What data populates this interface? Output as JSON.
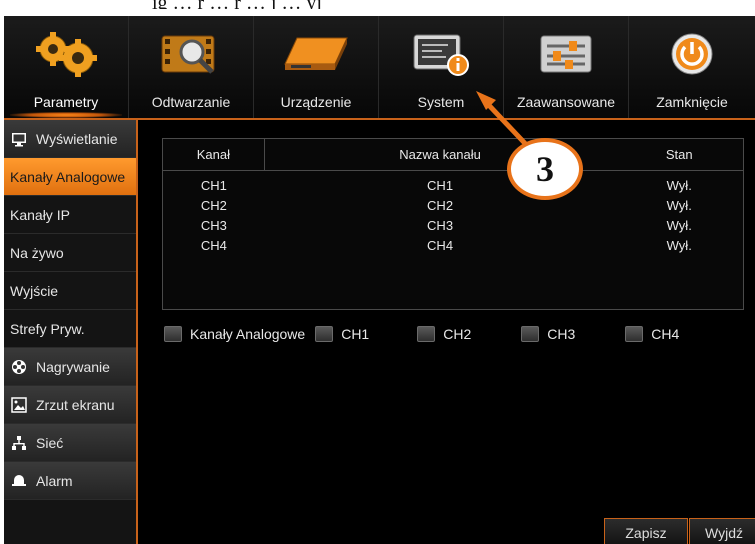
{
  "caption": {
    "text": "ig … ŕ … ŕ … j … yj"
  },
  "toolbar": {
    "items": [
      {
        "label": "Parametry",
        "icon": "gears-icon",
        "active": true
      },
      {
        "label": "Odtwarzanie",
        "icon": "film-search-icon",
        "active": false
      },
      {
        "label": "Urządzenie",
        "icon": "hard-drive-icon",
        "active": false
      },
      {
        "label": "System",
        "icon": "system-info-icon",
        "active": false
      },
      {
        "label": "Zaawansowane",
        "icon": "sliders-icon",
        "active": false
      },
      {
        "label": "Zamknięcie",
        "icon": "power-icon",
        "active": false
      }
    ]
  },
  "sidebar": {
    "items": [
      {
        "label": "Wyświetlanie",
        "icon": "monitor-icon",
        "kind": "section"
      },
      {
        "label": "Kanały Analogowe",
        "kind": "active"
      },
      {
        "label": "Kanały IP",
        "kind": "sub"
      },
      {
        "label": "Na żywo",
        "kind": "sub"
      },
      {
        "label": "Wyjście",
        "kind": "sub"
      },
      {
        "label": "Strefy Pryw.",
        "kind": "sub"
      },
      {
        "label": "Nagrywanie",
        "icon": "reel-icon",
        "kind": "section"
      },
      {
        "label": "Zrzut ekranu",
        "icon": "image-icon",
        "kind": "section"
      },
      {
        "label": "Sieć",
        "icon": "network-icon",
        "kind": "section"
      },
      {
        "label": "Alarm",
        "icon": "bell-icon",
        "kind": "section"
      }
    ]
  },
  "table": {
    "headers": [
      "Kanał",
      "Nazwa kanału",
      "Stan"
    ],
    "rows": [
      [
        "CH1",
        "CH1",
        "Wył."
      ],
      [
        "CH2",
        "CH2",
        "Wył."
      ],
      [
        "CH3",
        "CH3",
        "Wył."
      ],
      [
        "CH4",
        "CH4",
        "Wył."
      ]
    ]
  },
  "checkboxes": {
    "all_label": "Kanały Analogowe",
    "items": [
      "CH1",
      "CH2",
      "CH3",
      "CH4"
    ]
  },
  "buttons": {
    "save": "Zapisz",
    "exit": "Wyjdź"
  },
  "annotation": {
    "number": "3"
  },
  "colors": {
    "accent": "#e8731a",
    "active_tab": "#ff9a2e"
  }
}
